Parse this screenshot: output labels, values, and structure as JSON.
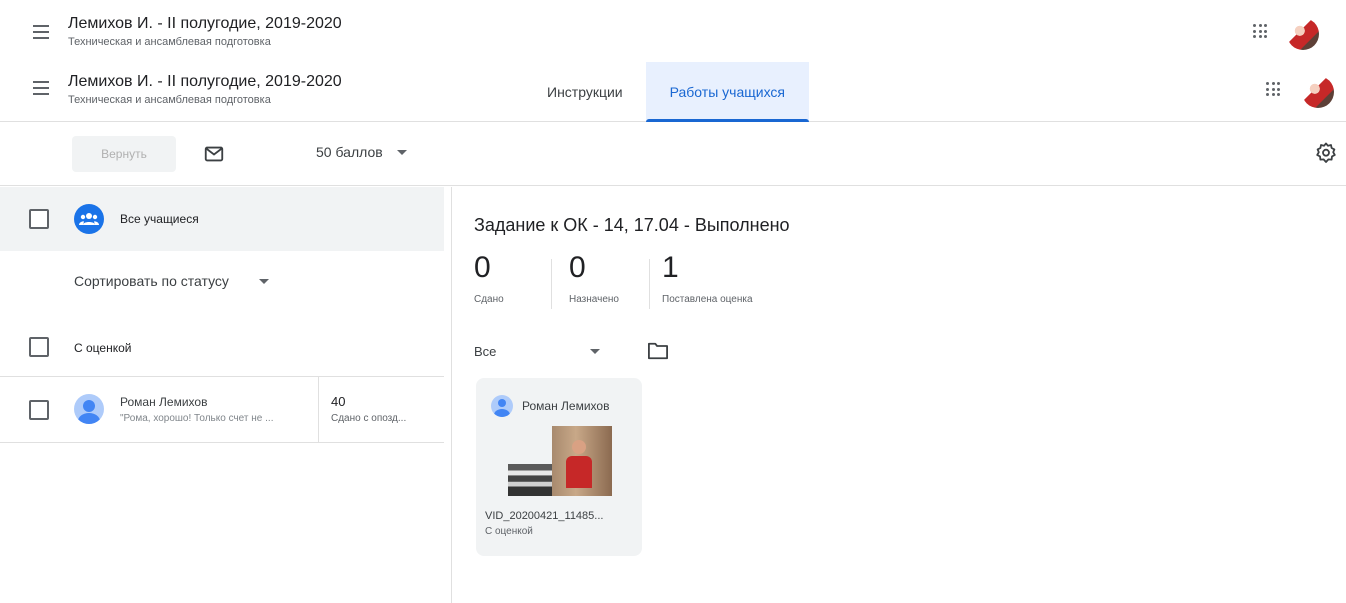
{
  "class": {
    "title": "Лемихов И. - II полугодие, 2019-2020",
    "subtitle": "Техническая и ансамблевая подготовка"
  },
  "tabs": [
    {
      "label": "Инструкции",
      "active": false
    },
    {
      "label": "Работы учащихся",
      "active": true
    }
  ],
  "toolbar": {
    "return_label": "Вернуть",
    "points_label": "50 баллов"
  },
  "roster": {
    "all_students_label": "Все учащиеся",
    "sort_label": "Сортировать по статусу",
    "graded_section_label": "С оценкой",
    "students": [
      {
        "name": "Роман Лемихов",
        "comment": "\"Рома, хорошо! Только счет не ...",
        "grade": "40",
        "status": "Сдано с опозд..."
      }
    ]
  },
  "assignment": {
    "title": "Задание к ОК - 14, 17.04 - Выполнено",
    "stats": [
      {
        "value": "0",
        "label": "Сдано"
      },
      {
        "value": "0",
        "label": "Назначено"
      },
      {
        "value": "1",
        "label": "Поставлена оценка"
      }
    ],
    "filter_label": "Все",
    "submissions": [
      {
        "student": "Роман Лемихов",
        "file": "VID_20200421_11485...",
        "status": "С оценкой"
      }
    ]
  },
  "colors": {
    "accent": "#1967d2",
    "active_tab_bg": "#e8f0fe",
    "selected_row_bg": "#f1f3f4"
  }
}
